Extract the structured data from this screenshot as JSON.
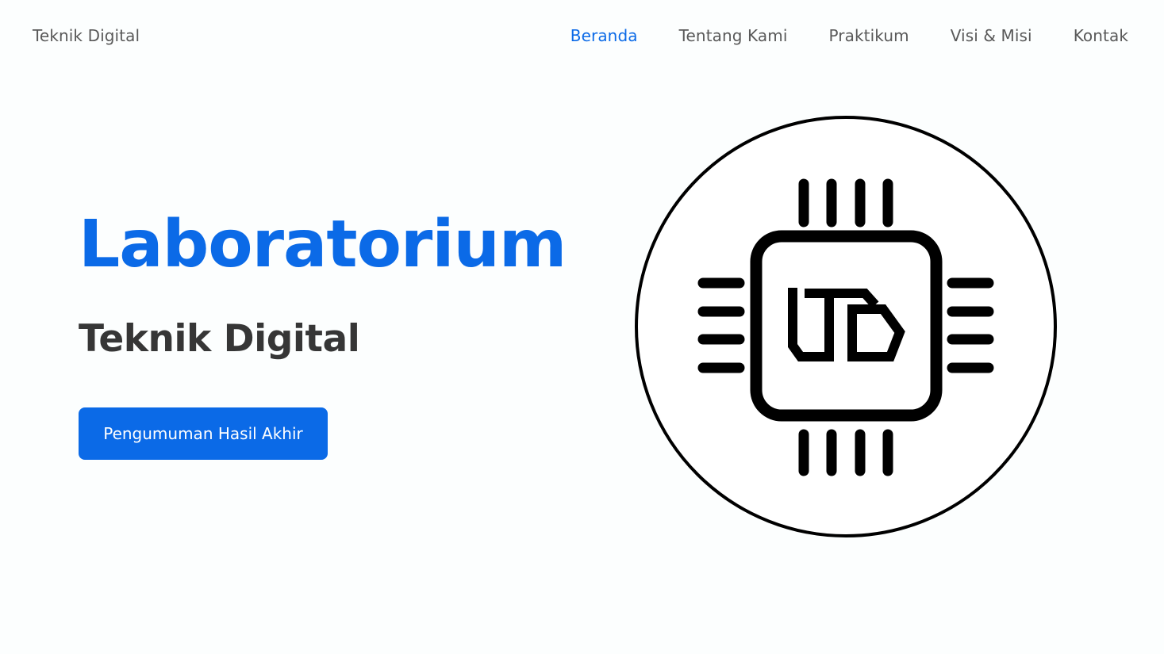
{
  "navbar": {
    "brand": "Teknik Digital",
    "items": [
      {
        "label": "Beranda",
        "active": true
      },
      {
        "label": "Tentang Kami",
        "active": false
      },
      {
        "label": "Praktikum",
        "active": false
      },
      {
        "label": "Visi & Misi",
        "active": false
      },
      {
        "label": "Kontak",
        "active": false
      }
    ]
  },
  "hero": {
    "title": "Laboratorium",
    "subtitle": "Teknik Digital",
    "button_label": "Pengumuman Hasil Akhir",
    "logo_text": "LTD"
  },
  "colors": {
    "accent": "#0b6ae7",
    "text_dark": "#363636",
    "text_muted": "#595959",
    "background": "#fcfefe"
  },
  "icons": {
    "logo": "chip-logo-icon"
  }
}
